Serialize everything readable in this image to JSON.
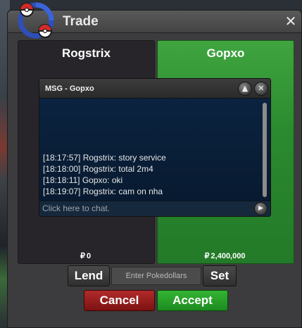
{
  "window": {
    "title": "Trade",
    "close_symbol": "✕"
  },
  "players": {
    "left": {
      "name": "Rogstrix",
      "money": "0"
    },
    "right": {
      "name": "Gopxo",
      "money": "2,400,000"
    },
    "currency_symbol": "₽"
  },
  "chat": {
    "title": "MSG - Gopxo",
    "messages": [
      "[18:17:57] Rogstrix: story service",
      "[18:18:00] Rogstrix: total 2m4",
      "[18:18:11] Gopxo: oki",
      "[18:19:07] Rogstrix: cam on nha"
    ],
    "input_placeholder": "Click here to chat."
  },
  "controls": {
    "lend_label": "Lend",
    "amount_placeholder": "Enter Pokedollars",
    "set_label": "Set",
    "cancel_label": "Cancel",
    "accept_label": "Accept"
  },
  "colors": {
    "accept_panel": "#2b8a2f",
    "cancel": "#9a1f1f",
    "accept": "#27a128"
  }
}
